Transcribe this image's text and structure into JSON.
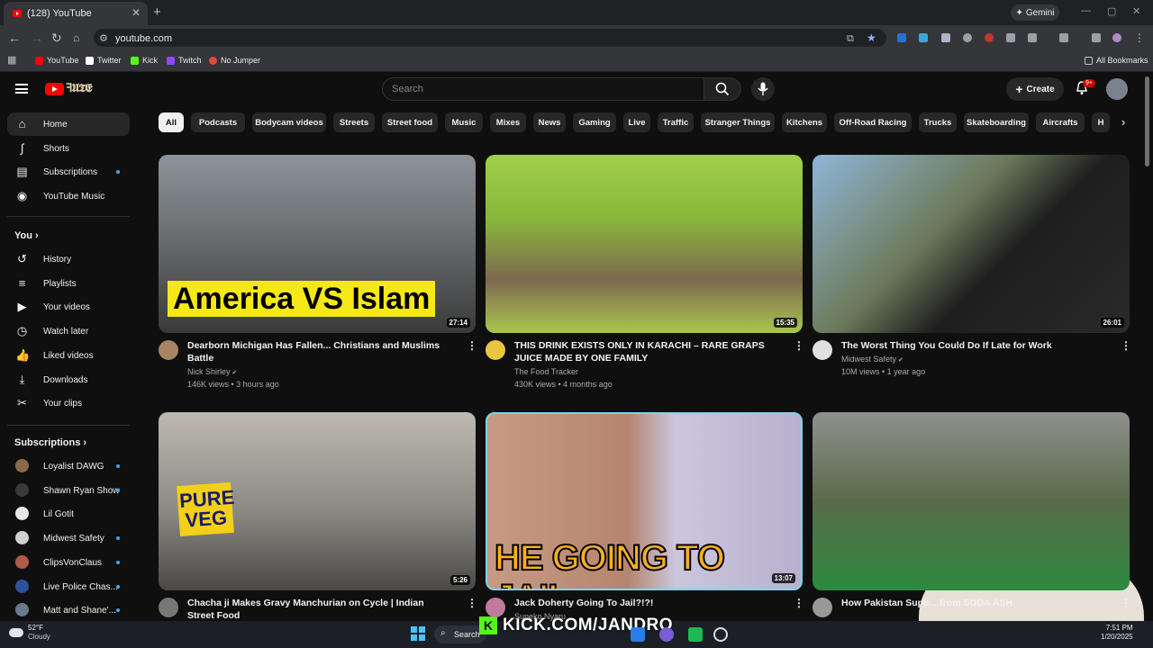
{
  "browser": {
    "tab_title": "(128) YouTube",
    "tab_close": "✕",
    "new_tab": "+",
    "gemini": "Gemini",
    "url": "youtube.com",
    "bookmarks": [
      "YouTube",
      "Twitter",
      "Kick",
      "Twitch",
      "No Jumper"
    ],
    "all_bookmarks": "All Bookmarks"
  },
  "header": {
    "brand": "ꟻ𝖀𝕿𝕰",
    "search_placeholder": "Search",
    "create_label": "Create",
    "notifications_badge": "9+"
  },
  "sidebar": {
    "main": [
      {
        "label": "Home",
        "icon": "home-icon",
        "active": true
      },
      {
        "label": "Shorts",
        "icon": "shorts-icon"
      },
      {
        "label": "Subscriptions",
        "icon": "subscriptions-icon",
        "dot": true
      },
      {
        "label": "YouTube Music",
        "icon": "music-icon"
      }
    ],
    "you_heading": "You",
    "you": [
      {
        "label": "History",
        "icon": "history-icon"
      },
      {
        "label": "Playlists",
        "icon": "playlists-icon"
      },
      {
        "label": "Your videos",
        "icon": "your-videos-icon"
      },
      {
        "label": "Watch later",
        "icon": "watch-later-icon"
      },
      {
        "label": "Liked videos",
        "icon": "liked-icon"
      },
      {
        "label": "Downloads",
        "icon": "downloads-icon"
      },
      {
        "label": "Your clips",
        "icon": "clips-icon"
      }
    ],
    "subs_heading": "Subscriptions",
    "subscriptions": [
      {
        "label": "Loyalist DAWG",
        "color": "#8a6a4a",
        "dot": true
      },
      {
        "label": "Shawn Ryan Show",
        "color": "#3a3a3a",
        "dot": true
      },
      {
        "label": "Lil Gotit",
        "color": "#e8e8e8",
        "dot": false
      },
      {
        "label": "Midwest Safety",
        "color": "#d0d0d0",
        "dot": true
      },
      {
        "label": "ClipsVonClaus",
        "color": "#b05a4a",
        "dot": true
      },
      {
        "label": "Live Police Chas...",
        "color": "#2f4f9f",
        "dot": true
      },
      {
        "label": "Matt and Shane'...",
        "color": "#6a7a8a",
        "dot": true
      }
    ]
  },
  "chips": [
    "All",
    "Podcasts",
    "Bodycam videos",
    "Streets",
    "Street food",
    "Music",
    "Mixes",
    "News",
    "Gaming",
    "Live",
    "Traffic",
    "Stranger Things",
    "Kitchens",
    "Off-Road Racing",
    "Trucks",
    "Skateboarding",
    "Aircrafts",
    "H"
  ],
  "videos": [
    {
      "title": "Dearborn Michigan Has Fallen... Christians and Muslims Battle",
      "channel": "Nick Shirley",
      "verified": true,
      "meta": "146K views • 3 hours ago",
      "duration": "27:14",
      "thumb_text": "America VS Islam"
    },
    {
      "title": "THIS DRINK EXISTS ONLY IN KARACHI – RARE GRAPS JUICE MADE BY ONE FAMILY",
      "channel": "The Food Tracker",
      "verified": false,
      "meta": "430K views • 4 months ago",
      "duration": "15:35",
      "thumb_text": ""
    },
    {
      "title": "The Worst Thing You Could Do If Late for Work",
      "channel": "Midwest Safety",
      "verified": true,
      "meta": "10M views • 1 year ago",
      "duration": "26:01",
      "thumb_text": ""
    },
    {
      "title": "Chacha ji Makes Gravy Manchurian on Cycle | Indian Street Food",
      "channel": "",
      "verified": false,
      "meta": "",
      "duration": "5:26",
      "thumb_text": "PURE VEG"
    },
    {
      "title": "Jack Doherty Going To Jail?!?!",
      "channel": "Suneko Nyaru",
      "verified": false,
      "meta": "",
      "duration": "13:07",
      "thumb_text": "HE GOING TO JAIL"
    },
    {
      "title": "How Pakistan Supp... from SODA ASH",
      "channel": "",
      "verified": false,
      "meta": "",
      "duration": "",
      "thumb_text": ""
    }
  ],
  "overlay": {
    "stream_text": "KICK.COM/JANDRO"
  },
  "taskbar": {
    "weather_temp": "52°F",
    "weather_desc": "Cloudy",
    "search": "Search",
    "time": "7:51 PM",
    "date": "1/20/2025"
  }
}
